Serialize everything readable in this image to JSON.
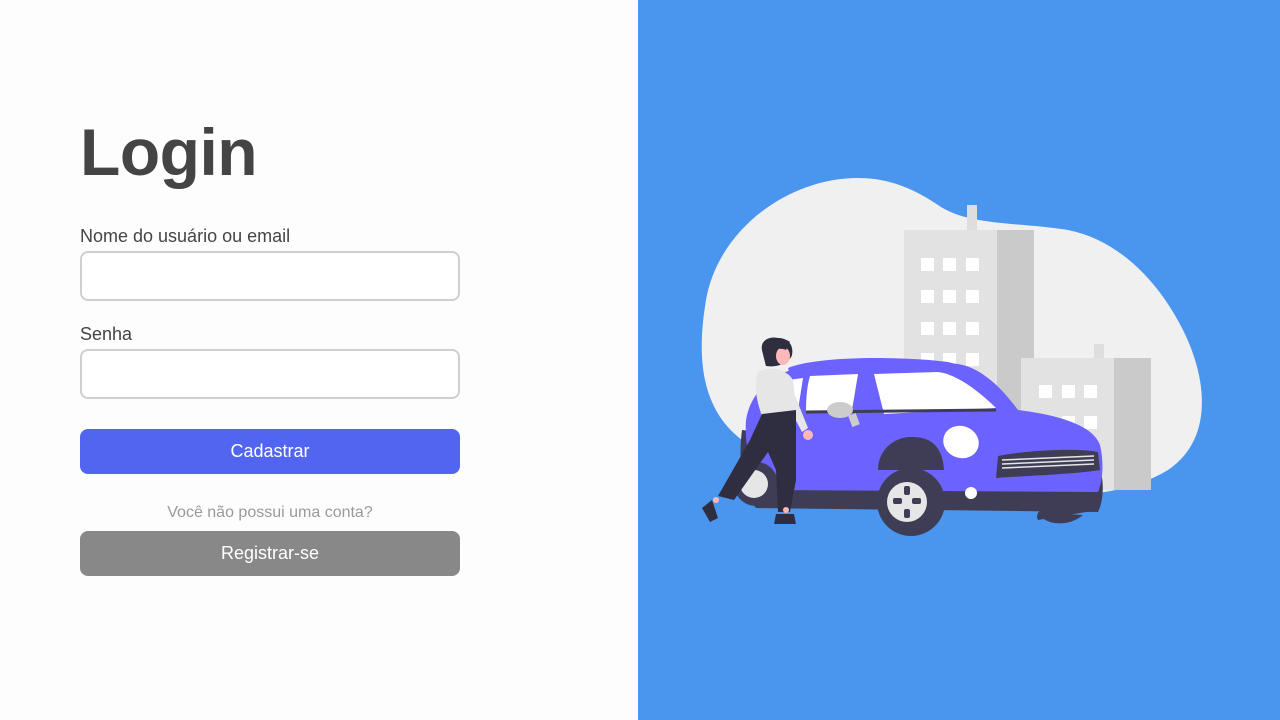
{
  "login": {
    "title": "Login",
    "username_label": "Nome do usuário ou email",
    "username_value": "",
    "password_label": "Senha",
    "password_value": "",
    "submit_label": "Cadastrar",
    "no_account_text": "Você não possui uma conta?",
    "register_label": "Registrar-se"
  },
  "illustration": {
    "subject": "woman standing next to a car in front of city buildings",
    "icon": "car-city-illustration"
  },
  "colors": {
    "right_panel_bg": "#4a96ee",
    "left_panel_bg": "#fdfdfd",
    "primary_button": "#5165f0",
    "secondary_button": "#888888",
    "title_text": "#444444",
    "car": "#6c63ff"
  }
}
